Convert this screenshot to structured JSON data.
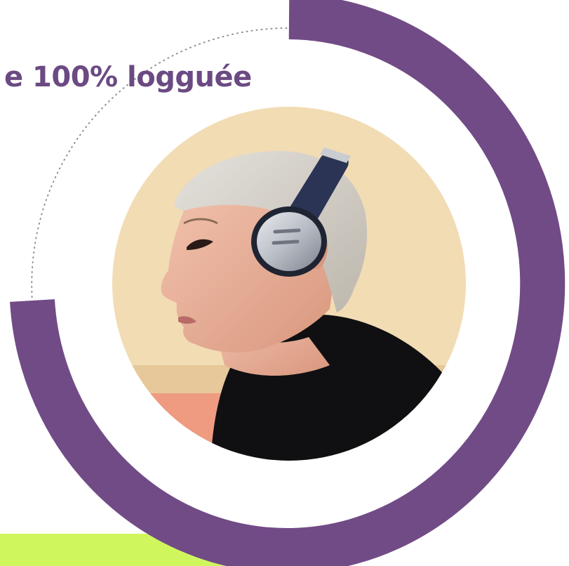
{
  "hero": {
    "headline": "e 100% logguée",
    "photo_subject": "woman-with-headphones"
  },
  "progress_ring": {
    "percent": 100
  },
  "colors": {
    "brand_purple": "#714b86",
    "headline_purple": "#6b4a83",
    "dotted_guide": "#8f8f8f",
    "lime_accent": "#d0f65e",
    "photo_background": "#f2dcb4",
    "photo_wall_shadow": "#e6c89a",
    "photo_floor": "#ee9b82",
    "hair": "#d7d3cd",
    "skin": "#e9b29d",
    "sweater": "#101013",
    "headphone_silver": "#b7bcc4",
    "headphone_band": "#2b3454"
  }
}
